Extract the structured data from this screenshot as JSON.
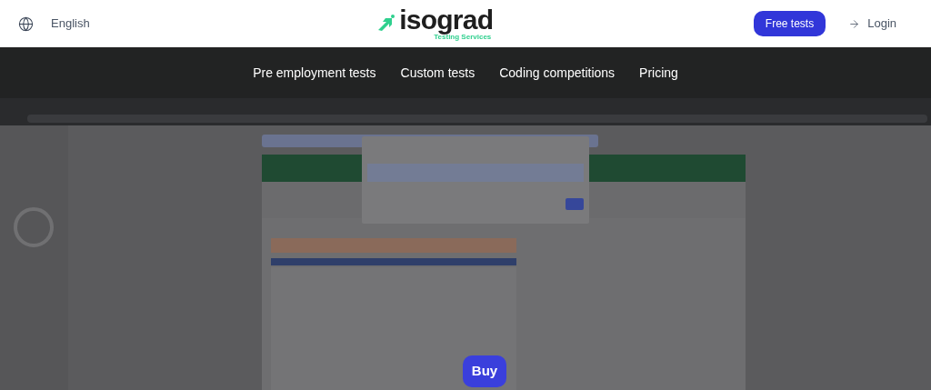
{
  "header": {
    "language": "English",
    "logo": {
      "name": "isograd",
      "tagline": "Testing Services"
    },
    "buttons": [
      {
        "label": "Free tests",
        "kind": "primary"
      },
      {
        "label": "Login",
        "kind": "link"
      }
    ]
  },
  "nav": {
    "items": [
      {
        "label": "Pre employment tests"
      },
      {
        "label": "Custom tests"
      },
      {
        "label": "Coding competitions"
      },
      {
        "label": "Pricing"
      }
    ]
  },
  "demo": {
    "kind": "picture",
    "button": "Buy"
  }
}
